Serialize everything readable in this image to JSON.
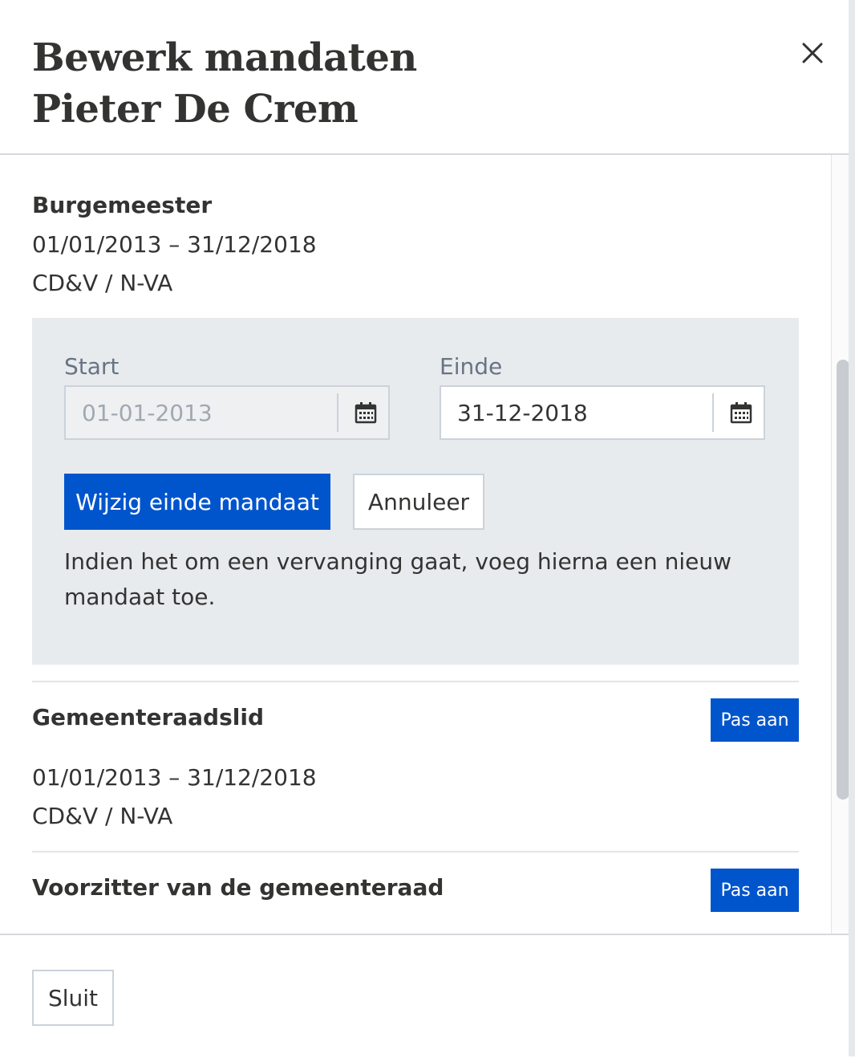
{
  "modal": {
    "title_line1": "Bewerk mandaten",
    "title_line2": "Pieter De Crem",
    "close_icon": "close-icon"
  },
  "mandates": [
    {
      "title": "Burgemeester",
      "period": "01/01/2013 – 31/12/2018",
      "party": "CD&V / N-VA"
    },
    {
      "title": "Gemeenteraadslid",
      "period": "01/01/2013 – 31/12/2018",
      "party": "CD&V / N-VA",
      "edit_label": "Pas aan"
    },
    {
      "title": "Voorzitter van de gemeenteraad",
      "edit_label": "Pas aan"
    }
  ],
  "edit_panel": {
    "start_label": "Start",
    "start_value": "01-01-2013",
    "end_label": "Einde",
    "end_value": "31-12-2018",
    "calendar_icon": "calendar-icon",
    "submit_label": "Wijzig einde mandaat",
    "cancel_label": "Annuleer",
    "note": "Indien het om een vervanging gaat, voeg hierna een nieuw mandaat toe."
  },
  "footer": {
    "close_label": "Sluit"
  },
  "colors": {
    "primary": "#0055cc",
    "panel_bg": "#e8ebee",
    "text": "#333332",
    "muted": "#687483"
  }
}
